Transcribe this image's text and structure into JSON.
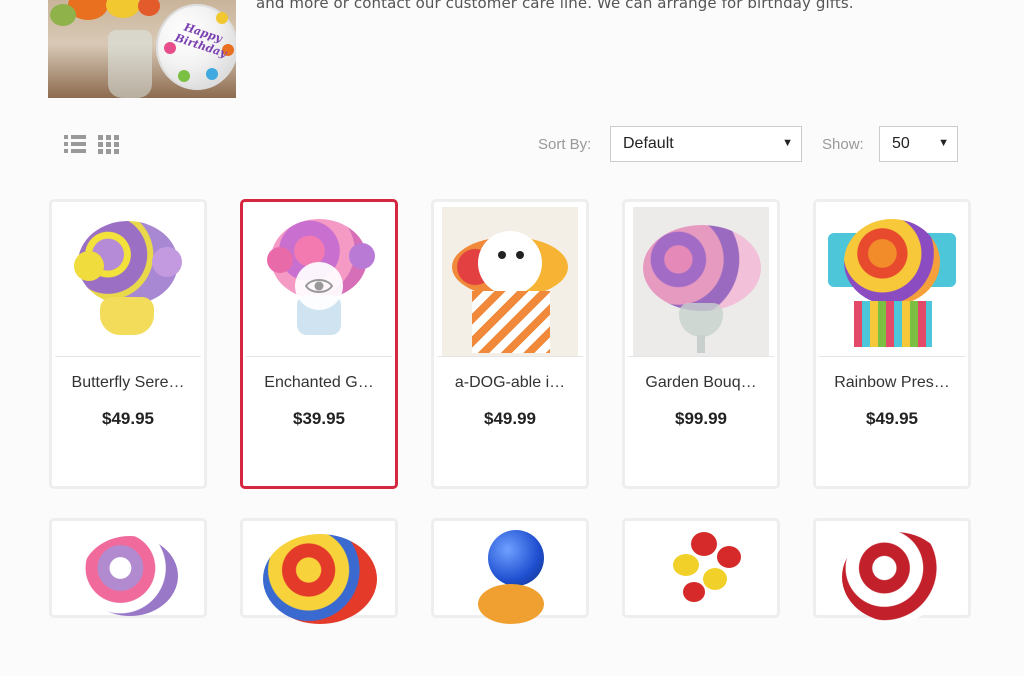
{
  "intro": {
    "text": "and more or contact our customer care line. We can arrange for birthday gifts.",
    "banner_balloon_text": "Happy Birthday"
  },
  "toolbar": {
    "sort_label": "Sort By:",
    "sort_value": "Default",
    "show_label": "Show:",
    "show_value": "50"
  },
  "products": [
    {
      "name": "Butterfly Sere…",
      "price": "$49.95"
    },
    {
      "name": "Enchanted G…",
      "price": "$39.95"
    },
    {
      "name": "a-DOG-able i…",
      "price": "$49.99"
    },
    {
      "name": "Garden Bouq…",
      "price": "$99.99"
    },
    {
      "name": "Rainbow Pres…",
      "price": "$49.95"
    }
  ],
  "colors": {
    "active_border": "#d3283f",
    "card_border": "#eeeeee"
  }
}
